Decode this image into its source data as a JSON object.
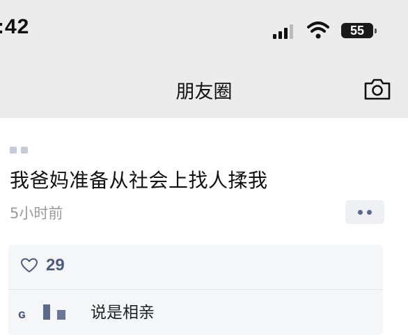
{
  "status_bar": {
    "time": ":42",
    "battery": "55",
    "signal_icon": "cellular-signal-icon",
    "wifi_icon": "wifi-icon"
  },
  "nav": {
    "title": "朋友圈",
    "camera_icon": "camera-icon"
  },
  "post": {
    "text": "我爸妈准备从社会上找人揉我",
    "time": "5小时前",
    "more_icon": "more-dots-icon",
    "likes": {
      "icon": "heart-icon",
      "count": "29"
    },
    "comments": [
      {
        "text": "说是相亲"
      }
    ]
  }
}
